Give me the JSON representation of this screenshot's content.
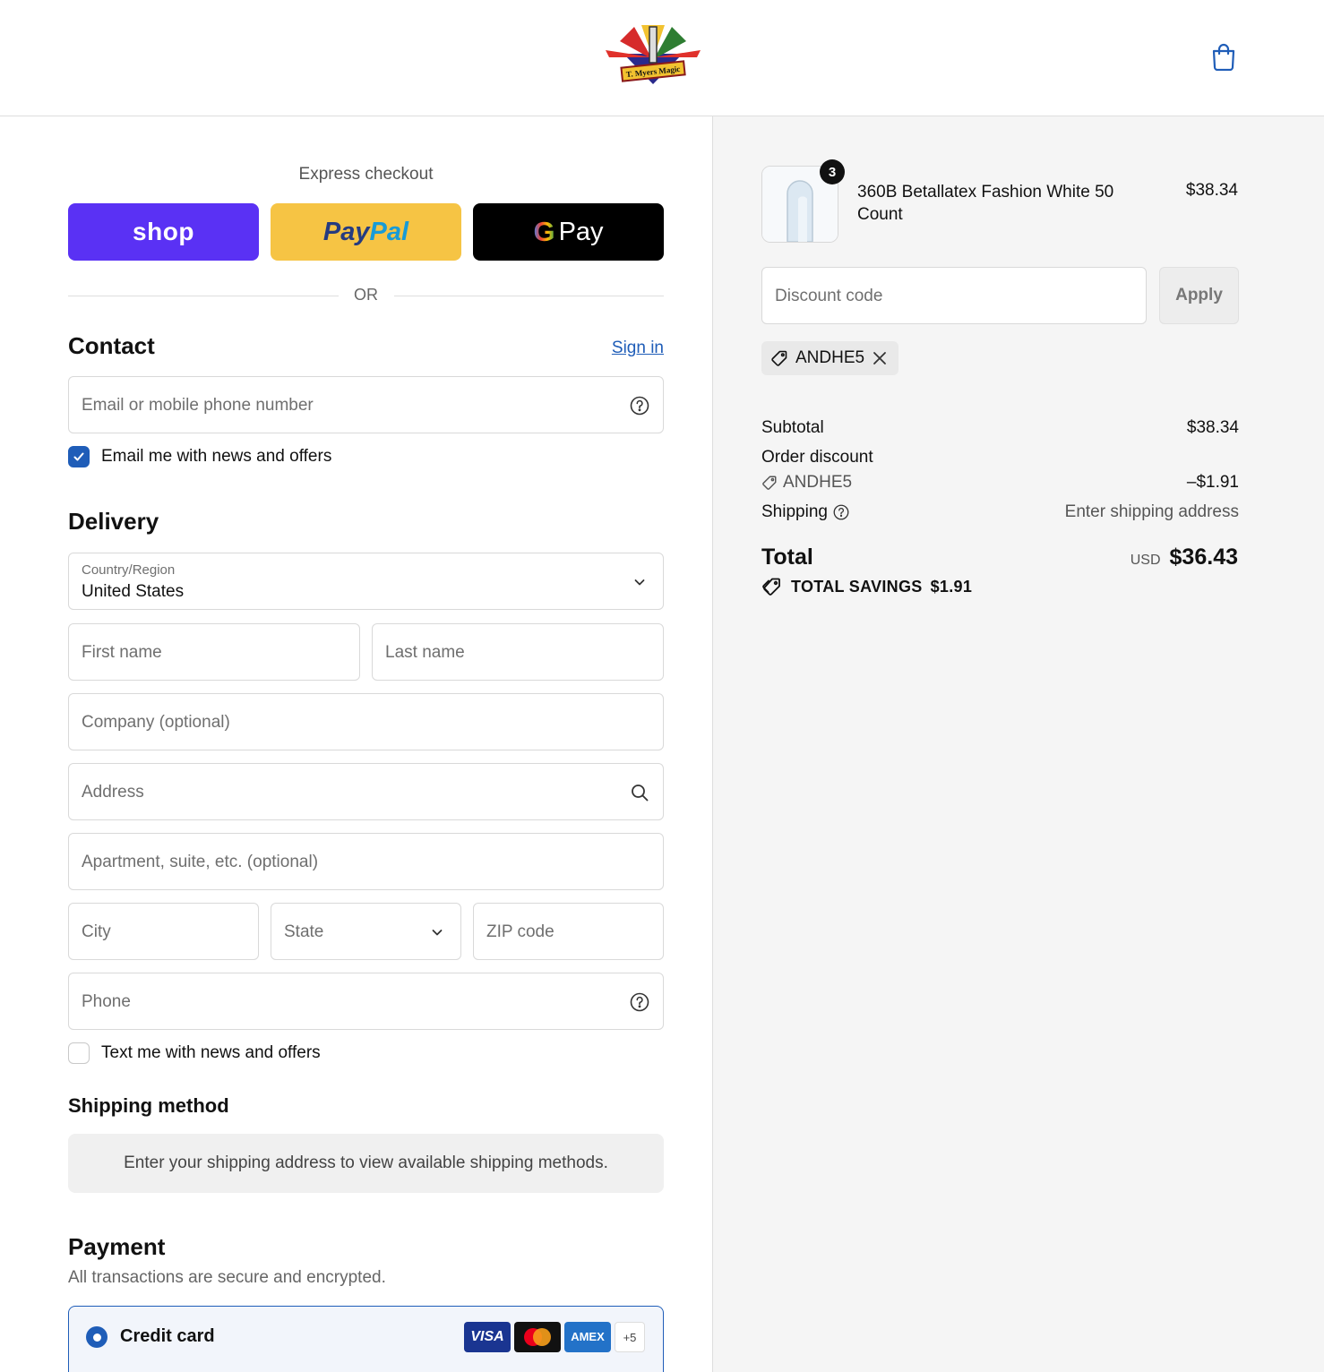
{
  "header": {
    "logo_text": "T. Myers Magic",
    "cart_icon": "shopping-bag-icon"
  },
  "express": {
    "title": "Express checkout",
    "shop_label": "shop",
    "paypal_label_1": "Pay",
    "paypal_label_2": "Pal",
    "gpay_g": "G",
    "gpay_label": "Pay",
    "or_label": "OR"
  },
  "contact": {
    "title": "Contact",
    "sign_in": "Sign in",
    "email_placeholder": "Email or mobile phone number",
    "news_label": "Email me with news and offers",
    "news_checked": true
  },
  "delivery": {
    "title": "Delivery",
    "country_label": "Country/Region",
    "country_value": "United States",
    "first_name": "First name",
    "last_name": "Last name",
    "company": "Company (optional)",
    "address": "Address",
    "apartment": "Apartment, suite, etc. (optional)",
    "city": "City",
    "state": "State",
    "zip": "ZIP code",
    "phone": "Phone",
    "text_label": "Text me with news and offers",
    "text_checked": false
  },
  "shipping_method": {
    "title": "Shipping method",
    "message": "Enter your shipping address to view available shipping methods."
  },
  "payment": {
    "title": "Payment",
    "subtitle": "All transactions are secure and encrypted.",
    "option_label": "Credit card",
    "cards": [
      "VISA",
      "Mastercard",
      "AMEX"
    ],
    "more_cards": "+5"
  },
  "summary": {
    "item": {
      "quantity": "3",
      "name": "360B Betallatex Fashion White 50 Count",
      "price": "$38.34"
    },
    "discount_placeholder": "Discount code",
    "apply_label": "Apply",
    "applied_code": "ANDHE5",
    "subtotal_label": "Subtotal",
    "subtotal_value": "$38.34",
    "order_discount_label": "Order discount",
    "order_discount_code": "ANDHE5",
    "order_discount_value": "–$1.91",
    "shipping_label": "Shipping",
    "shipping_value": "Enter shipping address",
    "total_label": "Total",
    "currency": "USD",
    "total_value": "$36.43",
    "savings_label": "TOTAL SAVINGS",
    "savings_value": "$1.91"
  },
  "colors": {
    "accent": "#1f5db8",
    "shop_purple": "#5a31f4",
    "paypal_yellow": "#f6c444",
    "sidebar_bg": "#f5f5f5"
  }
}
